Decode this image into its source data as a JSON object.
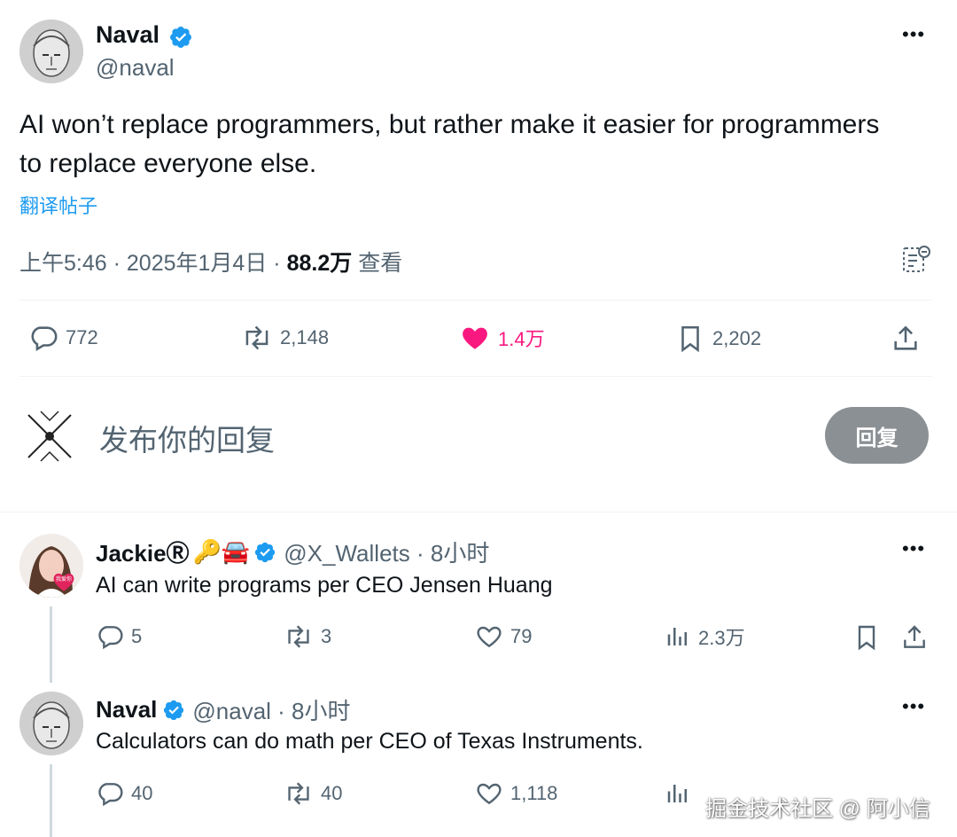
{
  "main_post": {
    "author_name": "Naval",
    "author_handle": "@naval",
    "text_line1": "AI won’t replace programmers, but rather make it easier for programmers",
    "text_line2": "to replace everyone else.",
    "translate_label": "翻译帖子",
    "time": "上午5:46",
    "separator": "·",
    "date": "2025年1月4日",
    "views_count": "88.2万",
    "views_label": "查看",
    "actions": {
      "replies": "772",
      "reposts": "2,148",
      "likes": "1.4万",
      "bookmarks": "2,202"
    }
  },
  "compose": {
    "placeholder": "发布你的回复",
    "reply_button": "回复"
  },
  "replies": [
    {
      "author_name": "JackieⓇ",
      "emoji": "🔑🚘",
      "handle_time": "@X_Wallets · 8小时",
      "text": "AI can write programs per CEO Jensen Huang",
      "avatar_badge": "我爱你",
      "actions": {
        "replies": "5",
        "reposts": "3",
        "likes": "79",
        "views": "2.3万"
      }
    },
    {
      "author_name": "Naval",
      "handle_time": "@naval · 8小时",
      "text": "Calculators can do math per CEO of Texas Instruments.",
      "actions": {
        "replies": "40",
        "reposts": "40",
        "likes": "1,118"
      }
    }
  ],
  "watermark": "掘金技术社区 @ 阿小信",
  "colors": {
    "text": "#0f1419",
    "muted": "#536471",
    "link": "#1d9bf0",
    "like": "#f91880",
    "verified": "#1d9bf0",
    "reply_button": "#8b9094"
  }
}
